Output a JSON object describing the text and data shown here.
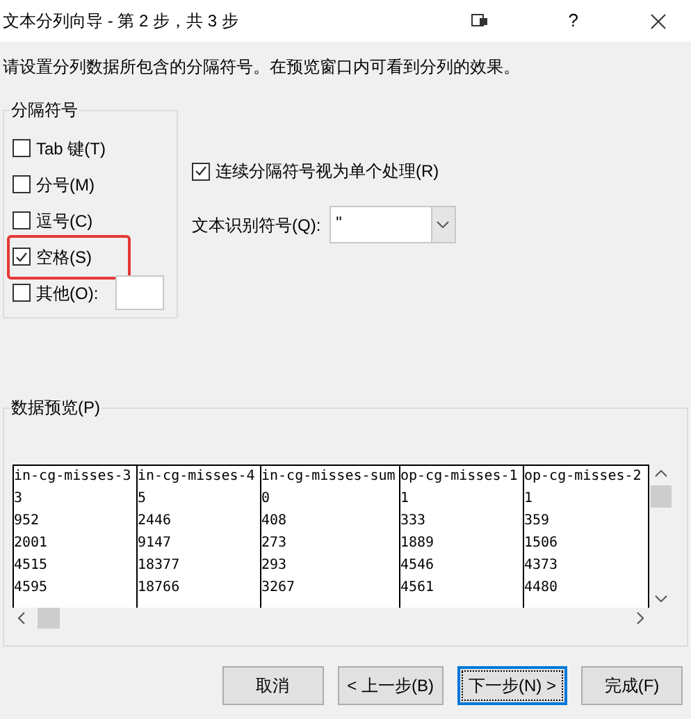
{
  "window": {
    "title": "文本分列向导 - 第 2 步，共 3 步",
    "help_button": "?"
  },
  "instruction": "请设置分列数据所包含的分隔符号。在预览窗口内可看到分列的效果。",
  "delimiters": {
    "title": "分隔符号",
    "options": [
      {
        "label": "Tab 键(T)",
        "checked": false,
        "highlighted": false
      },
      {
        "label": "分号(M)",
        "checked": false,
        "highlighted": false
      },
      {
        "label": "逗号(C)",
        "checked": false,
        "highlighted": false
      },
      {
        "label": "空格(S)",
        "checked": true,
        "highlighted": true
      },
      {
        "label": "其他(O):",
        "checked": false,
        "highlighted": false,
        "has_field": true
      }
    ]
  },
  "consecutive": {
    "label": "连续分隔符号视为单个处理(R)",
    "checked": true
  },
  "text_qualifier": {
    "label": "文本识别符号(Q):",
    "value": "\""
  },
  "preview": {
    "title": "数据预览(P)",
    "columns": [
      "in-cg-misses-3",
      "in-cg-misses-4",
      "in-cg-misses-sum",
      "op-cg-misses-1",
      "op-cg-misses-2"
    ],
    "rows": [
      [
        "3",
        "5",
        "0",
        "1",
        "1"
      ],
      [
        "952",
        "2446",
        "408",
        "333",
        "359"
      ],
      [
        "2001",
        "9147",
        "273",
        "1889",
        "1506"
      ],
      [
        "4515",
        "18377",
        "293",
        "4546",
        "4373"
      ],
      [
        "4595",
        "18766",
        "3267",
        "4561",
        "4480"
      ]
    ]
  },
  "buttons": [
    {
      "label": "取消",
      "focused": false
    },
    {
      "label": "< 上一步(B)",
      "focused": false
    },
    {
      "label": "下一步(N) >",
      "focused": true
    },
    {
      "label": "完成(F)",
      "focused": false
    }
  ]
}
